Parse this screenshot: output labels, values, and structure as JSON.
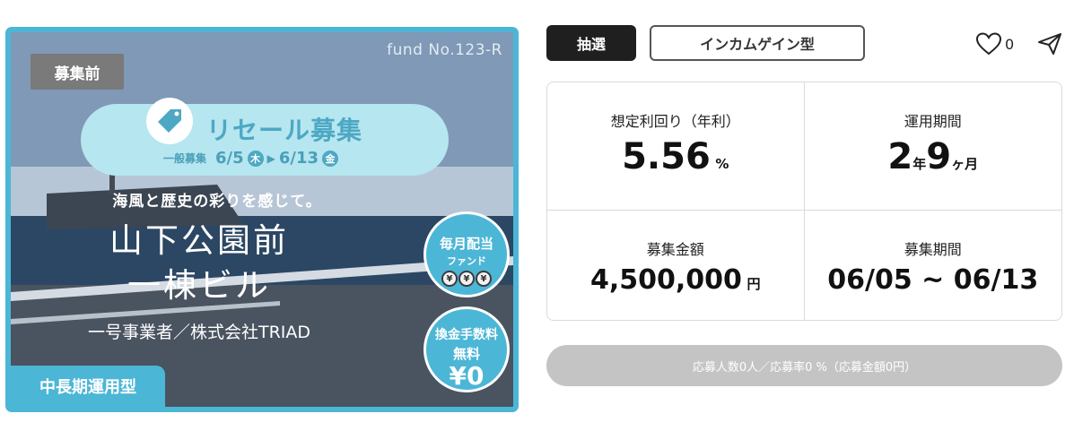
{
  "banner": {
    "fund_no": "fund No.123-R",
    "status_badge": "募集前",
    "resale_title": "リセール募集",
    "period_label": "一般募集",
    "start_date": "6/5",
    "start_weekday": "木",
    "end_date": "6/13",
    "end_weekday": "金",
    "catchphrase": "海風と歴史の彩りを感じて。",
    "property_line1": "山下公園前",
    "property_line2": "一棟ビル",
    "operator": "一号事業者／株式会社TRIAD",
    "monthly_badge_line1": "毎月配当",
    "monthly_badge_line2": "ファンド",
    "coin_symbol": "¥",
    "fee_badge_line1": "換金手数料",
    "fee_badge_line2": "無料",
    "fee_badge_line3": "¥0",
    "term_badge": "中長期運用型",
    "accent_color": "#4cb6d6"
  },
  "header": {
    "lottery_chip": "抽選",
    "type_chip": "インカムゲイン型",
    "favorite_count": "0",
    "icons": [
      "heart-icon",
      "send-icon"
    ]
  },
  "stats": {
    "yield": {
      "label": "想定利回り（年利）",
      "value": "5.56",
      "unit": "%"
    },
    "period": {
      "label": "運用期間",
      "years": "2",
      "years_unit": "年",
      "months": "9",
      "months_unit": "ヶ月"
    },
    "amount": {
      "label": "募集金額",
      "value": "4,500,000",
      "unit": "円"
    },
    "recruit": {
      "label": "募集期間",
      "value": "06/05 ~ 06/13"
    }
  },
  "apply_bar": {
    "text": "応募人数0人／応募率0 %（応募金額0円）"
  }
}
